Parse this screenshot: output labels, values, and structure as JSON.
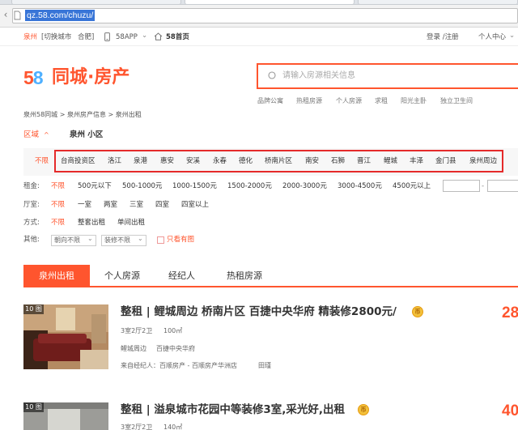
{
  "browser": {
    "url": "qz.58.com/chuzu/"
  },
  "topbar": {
    "city": "泉州",
    "switch_city": "[切换城市",
    "union": "合肥]",
    "app": "58APP",
    "app_chevron": "⌄",
    "home": "58首页",
    "login": "登录 /注册",
    "user_center": "个人中心",
    "user_chevron": "⌄"
  },
  "logo": {
    "brand_5": "5",
    "brand_8": "8",
    "text": "同城·房产"
  },
  "search": {
    "placeholder": "请输入房源相关信息",
    "hot_links": [
      "品牌公寓",
      "热租房源",
      "个人房源",
      "求租",
      "阳光主卧",
      "独立卫生间"
    ]
  },
  "breadcrumb": "泉州58同城 > 泉州房产信息 > 泉州出租",
  "region": {
    "label": "区域",
    "chevron": "^",
    "tab": "泉州 小区"
  },
  "districts": {
    "unlimited": "不限",
    "items": [
      "台商投资区",
      "洛江",
      "泉港",
      "惠安",
      "安溪",
      "永春",
      "德化",
      "桥南片区",
      "南安",
      "石狮",
      "晋江",
      "鲤城",
      "丰泽",
      "金门县",
      "泉州周边"
    ]
  },
  "filters": {
    "rent": {
      "label": "租金:",
      "unlimited": "不限",
      "options": [
        "500元以下",
        "500-1000元",
        "1000-1500元",
        "1500-2000元",
        "2000-3000元",
        "3000-4500元",
        "4500元以上"
      ],
      "range_dash": "-"
    },
    "rooms": {
      "label": "厅室:",
      "unlimited": "不限",
      "options": [
        "一室",
        "两室",
        "三室",
        "四室",
        "四室以上"
      ]
    },
    "mode": {
      "label": "方式:",
      "unlimited": "不限",
      "options": [
        "整套出租",
        "单间出租"
      ]
    },
    "other": {
      "label": "其他:",
      "orientation": "朝向不限",
      "decoration": "装修不限",
      "caret": "⌄",
      "only_image": "只看有图"
    }
  },
  "tabs": [
    "泉州出租",
    "个人房源",
    "经纪人",
    "热租房源"
  ],
  "listings": [
    {
      "photo_count": "10 图",
      "title": "整租 | 鲤城周边 桥南片区 百捷中央华府 精装修2800元/",
      "coin": "币",
      "rooms": "3室2厅2卫",
      "area": "100㎡",
      "location": "鲤城周边",
      "community": "百捷中央华府",
      "agent": "来自经纪人：百顺房产 - 百顺房产华洲店",
      "agent_name": "田瑾",
      "price": "28"
    },
    {
      "photo_count": "10 图",
      "title": "整租 | 溢泉城市花园中等装修3室,采光好,出租",
      "coin": "币",
      "rooms": "3室2厅2卫",
      "area": "140㎡",
      "price": "40"
    }
  ],
  "colors": {
    "accent": "#ff552e",
    "highlight_box": "#e52a2a",
    "url_selection": "#3875d7"
  }
}
